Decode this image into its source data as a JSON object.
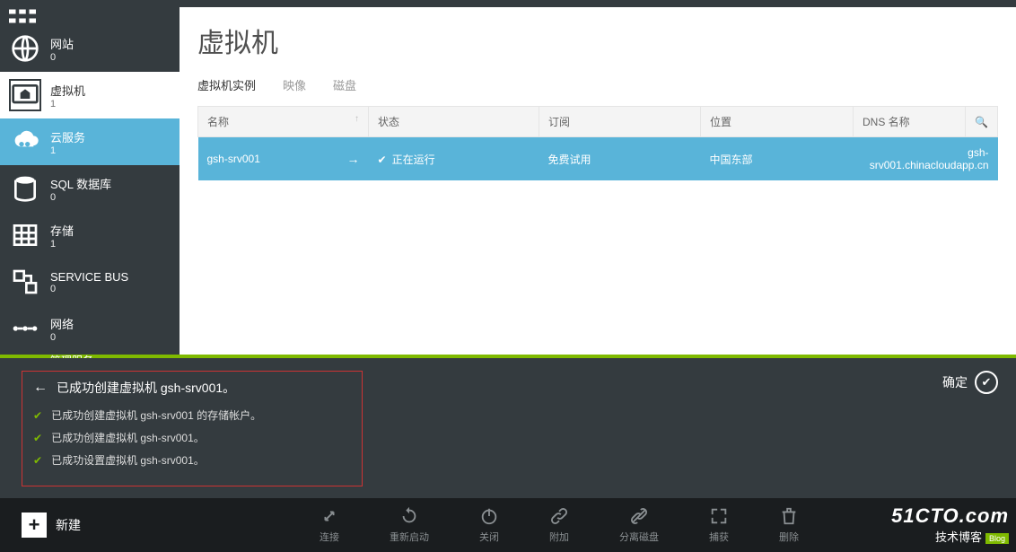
{
  "sidebar": {
    "items": [
      {
        "label": "网站",
        "count": "0"
      },
      {
        "label": "虚拟机",
        "count": "1"
      },
      {
        "label": "云服务",
        "count": "1"
      },
      {
        "label": "SQL 数据库",
        "count": "0"
      },
      {
        "label": "存储",
        "count": "1"
      },
      {
        "label": "SERVICE BUS",
        "count": "0"
      },
      {
        "label": "网络",
        "count": "0"
      },
      {
        "label": "管理服务",
        "count": ""
      }
    ]
  },
  "page": {
    "title": "虚拟机"
  },
  "tabs": [
    {
      "label": "虚拟机实例"
    },
    {
      "label": "映像"
    },
    {
      "label": "磁盘"
    }
  ],
  "columns": {
    "name": "名称",
    "status": "状态",
    "subscription": "订阅",
    "location": "位置",
    "dns": "DNS 名称"
  },
  "rows": [
    {
      "name": "gsh-srv001",
      "status": "正在运行",
      "subscription": "免费试用",
      "location": "中国东部",
      "dns": "gsh-srv001.chinacloudapp.cn"
    }
  ],
  "notif": {
    "title": "已成功创建虚拟机 gsh-srv001。",
    "lines": [
      "已成功创建虚拟机 gsh-srv001 的存储帐户。",
      "已成功创建虚拟机 gsh-srv001。",
      "已成功设置虚拟机 gsh-srv001。"
    ],
    "ok": "确定"
  },
  "bottom": {
    "newLabel": "新建",
    "actions": [
      {
        "label": "连接"
      },
      {
        "label": "重新启动"
      },
      {
        "label": "关闭"
      },
      {
        "label": "附加"
      },
      {
        "label": "分离磁盘"
      },
      {
        "label": "捕获"
      },
      {
        "label": "删除"
      }
    ]
  },
  "watermark": {
    "l1": "51CTO.com",
    "l2": "技术博客",
    "tag": "Blog"
  }
}
